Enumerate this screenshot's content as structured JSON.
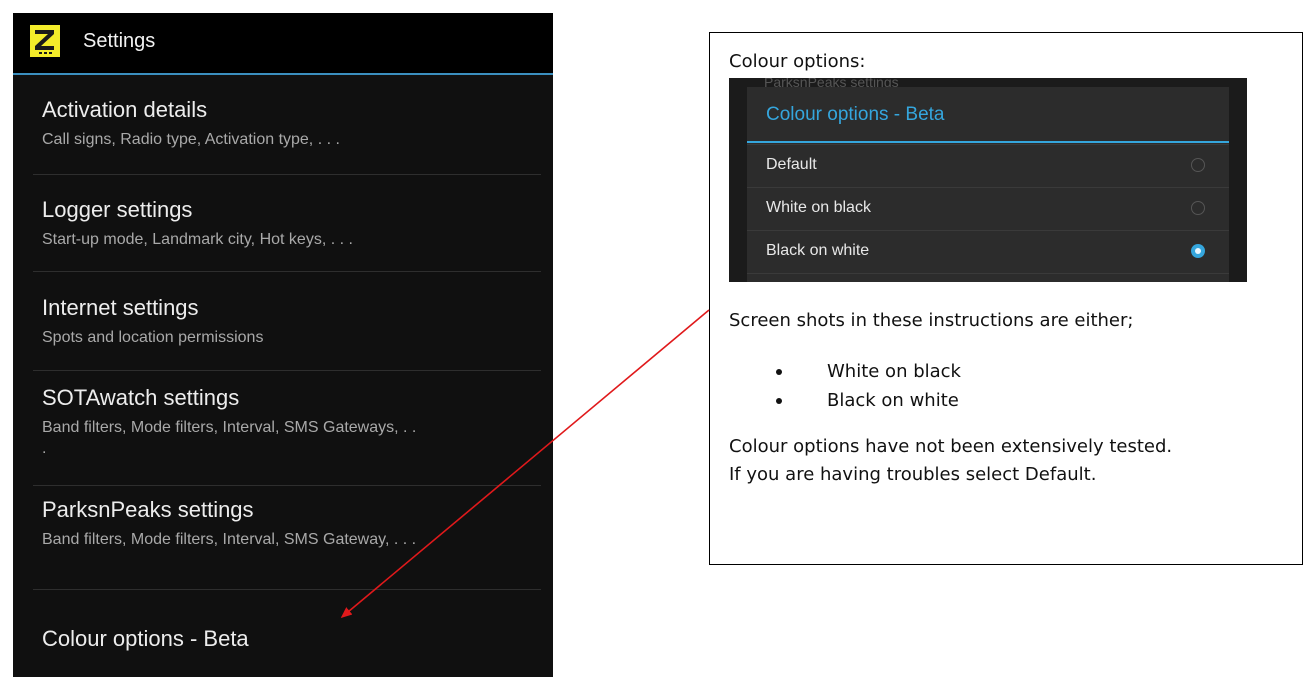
{
  "app": {
    "title": "Settings",
    "logo_icon": "logger-app-icon"
  },
  "settings_list": [
    {
      "title": "Activation details",
      "summary": "Call signs, Radio type, Activation type, . . ."
    },
    {
      "title": "Logger settings",
      "summary": "Start-up mode, Landmark city, Hot keys, . . ."
    },
    {
      "title": "Internet settings",
      "summary": "Spots and location permissions"
    },
    {
      "title": "SOTAwatch settings",
      "summary": "Band filters, Mode filters, Interval, SMS Gateways, . . ."
    },
    {
      "title": "ParksnPeaks settings",
      "summary": "Band filters, Mode filters, Interval, SMS Gateway, . . ."
    },
    {
      "title": "Colour options - Beta",
      "summary": ""
    }
  ],
  "callout": {
    "heading": "Colour options:",
    "dialog": {
      "background_text": "ParksnPeaks settings",
      "title": "Colour options - Beta",
      "options": [
        {
          "label": "Default",
          "selected": false
        },
        {
          "label": "White on black",
          "selected": false
        },
        {
          "label": "Black on white",
          "selected": true
        }
      ]
    },
    "intro": "Screen shots in these instructions are either;",
    "bullets": [
      "White on black",
      "Black on white"
    ],
    "note_line1": "Colour options have not been extensively tested.",
    "note_line2": "If you are having troubles select Default."
  },
  "colors": {
    "accent": "#35a6dd",
    "arrow": "#e0191b",
    "logo_bg": "#f3ec2a"
  }
}
